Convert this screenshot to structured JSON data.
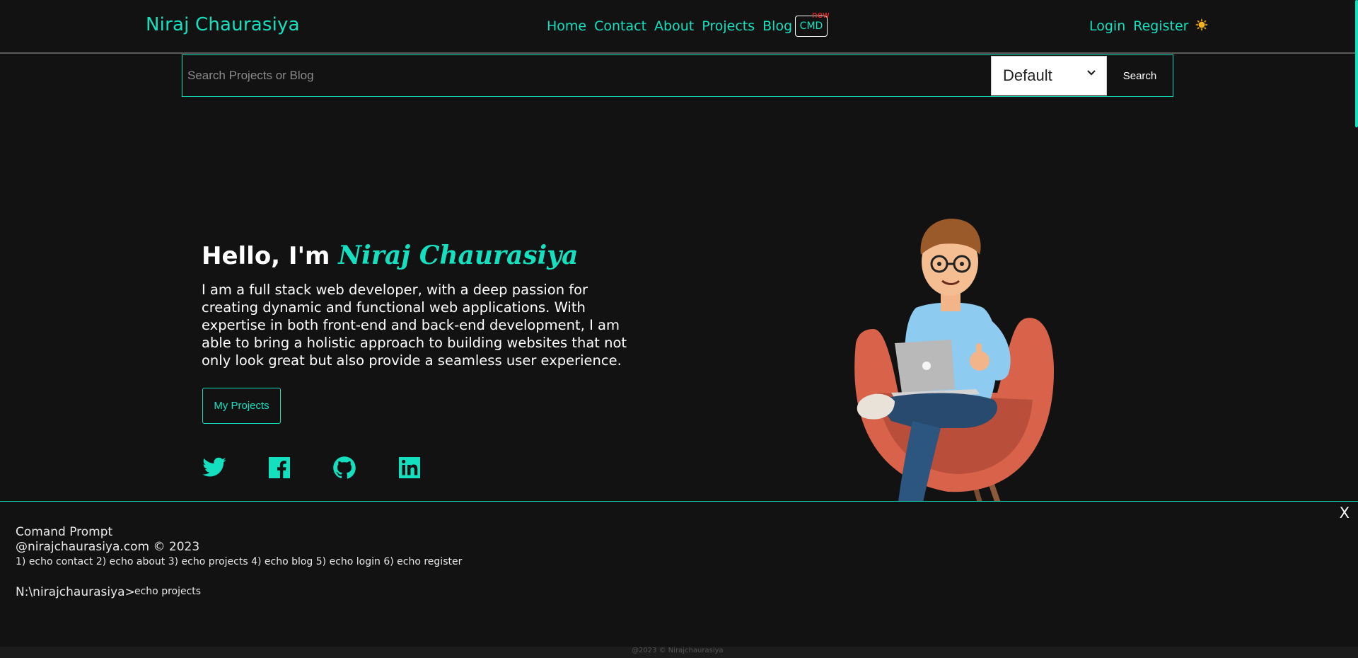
{
  "nav": {
    "brand": "Niraj Chaurasiya",
    "links": [
      "Home",
      "Contact",
      "About",
      "Projects",
      "Blog"
    ],
    "cmd_label": "CMD",
    "new_badge": "new",
    "login": "Login",
    "register": "Register",
    "theme_icon": "sun-icon"
  },
  "search": {
    "placeholder": "Search Projects or Blog",
    "value": "",
    "sort_selected": "Default",
    "button": "Search"
  },
  "hero": {
    "greeting": "Hello, I'm ",
    "name": "Niraj Chaurasiya",
    "description": "I am a full stack web developer, with a deep passion for creating dynamic and functional web applications. With expertise in both front-end and back-end development, I am able to bring a holistic approach to building websites that not only look great but also provide a seamless user experience.",
    "button": "My Projects",
    "socials": [
      "twitter-icon",
      "facebook-icon",
      "github-icon",
      "linkedin-icon"
    ]
  },
  "cmd": {
    "close": "X",
    "title": "Comand Prompt",
    "copyright": "@nirajchaurasiya.com © 2023",
    "help": "1) echo contact 2) echo about 3) echo projects 4) echo blog 5) echo login 6) echo register",
    "prompt": "N:\\nirajchaurasiya>",
    "input_value": "echo projects"
  },
  "footer": {
    "text": "@2023 © Nirajchaurasiya"
  },
  "colors": {
    "accent": "#14e0bf",
    "background": "#121212",
    "badge": "#ff2626"
  }
}
